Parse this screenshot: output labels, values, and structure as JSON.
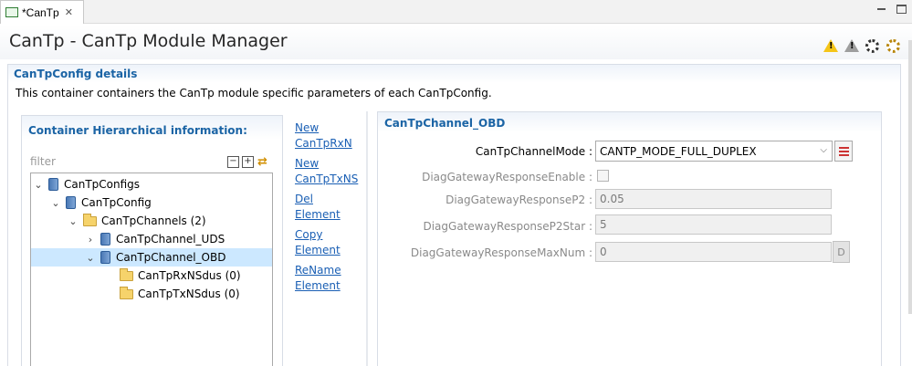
{
  "tab": {
    "label": "*CanTp"
  },
  "header": {
    "title": "CanTp - CanTp Module Manager"
  },
  "details": {
    "title": "CanTpConfig details",
    "description": "This container containers the CanTp module specific parameters of each CanTpConfig."
  },
  "hierarchy": {
    "title": "Container Hierarchical information:",
    "filter_placeholder": "filter",
    "filter_value": "",
    "tree": [
      {
        "label": "CanTpConfigs",
        "icon": "module-icon",
        "twisty": "expanded"
      },
      {
        "label": "CanTpConfig",
        "icon": "module-icon",
        "twisty": "expanded"
      },
      {
        "label": "CanTpChannels (2)",
        "icon": "folder-icon",
        "twisty": "expanded"
      },
      {
        "label": "CanTpChannel_UDS",
        "icon": "module-icon",
        "twisty": "collapsed"
      },
      {
        "label": "CanTpChannel_OBD",
        "icon": "module-icon",
        "twisty": "expanded",
        "selected": true
      },
      {
        "label": "CanTpRxNSdus (0)",
        "icon": "folder-icon",
        "twisty": "none"
      },
      {
        "label": "CanTpTxNSdus (0)",
        "icon": "folder-icon",
        "twisty": "none"
      }
    ]
  },
  "actions": {
    "new_rxn_line1": "New",
    "new_rxn_line2": "CanTpRxN",
    "new_txns_line1": "New",
    "new_txns_line2": "CanTpTxNS",
    "del_line1": "Del",
    "del_line2": "Element",
    "copy_line1": "Copy",
    "copy_line2": "Element",
    "rename_line1": "ReName",
    "rename_line2": "Element"
  },
  "properties": {
    "title": "CanTpChannel_OBD",
    "channel_mode_label": "CanTpChannelMode :",
    "channel_mode_value": "CANTP_MODE_FULL_DUPLEX",
    "gw_enable_label": "DiagGatewayResponseEnable :",
    "gw_enable_checked": false,
    "gw_p2_label": "DiagGatewayResponseP2 :",
    "gw_p2_value": "0.05",
    "gw_p2star_label": "DiagGatewayResponseP2Star :",
    "gw_p2star_value": "5",
    "gw_maxnum_label": "DiagGatewayResponseMaxNum :",
    "gw_maxnum_value": "0",
    "d_button_label": "D"
  },
  "colors": {
    "section_title": "#1b64a5",
    "link": "#1a5fb4",
    "selected_row": "#cce8ff"
  }
}
